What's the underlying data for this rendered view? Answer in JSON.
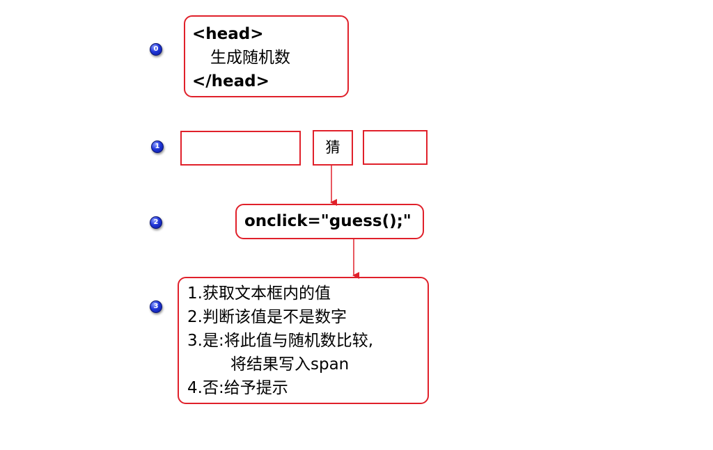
{
  "markers": [
    "0",
    "1",
    "2",
    "3"
  ],
  "head_box": {
    "open_tag": "<head>",
    "content": "生成随机数",
    "close_tag": "</head>"
  },
  "controls": {
    "guess_button": "猜"
  },
  "onclick_code": "onclick=\"guess();\"",
  "steps": [
    "1.获取文本框内的值",
    "2.判断该值是不是数字",
    "3.是:将此值与随机数比较,",
    "将结果写入span",
    "4.否:给予提示"
  ],
  "colors": {
    "box_border": "#e0202a",
    "arrow": "#e0202a",
    "marker": "#2036d8"
  }
}
